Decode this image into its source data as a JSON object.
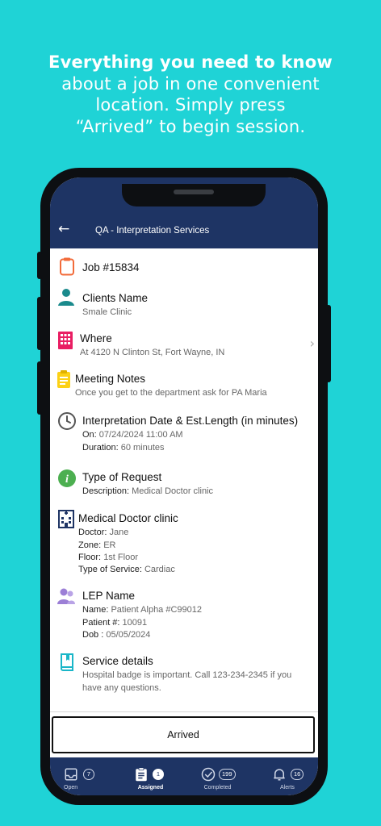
{
  "headline": {
    "bold": "Everything you need to know",
    "line2": "about a job in one convenient",
    "line3": "location. Simply press",
    "line4": "“Arrived” to begin session."
  },
  "appbar": {
    "back": "←",
    "title": "QA - Interpretation Services"
  },
  "job": {
    "title": "Job #15834"
  },
  "client": {
    "title": "Clients Name",
    "value": "Smale Clinic"
  },
  "where": {
    "title": "Where",
    "value": "At 4120 N Clinton St, Fort Wayne, IN"
  },
  "notes": {
    "title": "Meeting Notes",
    "value": "Once you get to the department ask for PA Maria"
  },
  "date": {
    "title": "Interpretation Date & Est.Length (in minutes)",
    "on_label": "On:",
    "on_value": "07/24/2024 11:00 AM",
    "duration_label": "Duration:",
    "duration_value": "60 minutes"
  },
  "request": {
    "title": "Type of Request",
    "desc_label": "Description:",
    "desc_value": "Medical Doctor clinic"
  },
  "clinic": {
    "title": "Medical Doctor clinic",
    "doctor_label": "Doctor:",
    "doctor_value": "Jane",
    "zone_label": "Zone:",
    "zone_value": "ER",
    "floor_label": "Floor:",
    "floor_value": "1st Floor",
    "service_label": "Type of Service:",
    "service_value": "Cardiac"
  },
  "lep": {
    "title": "LEP Name",
    "name_label": "Name:",
    "name_value": "Patient  Alpha #C99012",
    "patient_label": "Patient #:",
    "patient_value": "10091",
    "dob_label": "Dob :",
    "dob_value": "05/05/2024"
  },
  "service": {
    "title": "Service details",
    "value": "Hospital badge is important. Call 123-234-2345 if you have any questions."
  },
  "arrived_button": "Arrived",
  "tabs": [
    {
      "label": "Open",
      "count": "7",
      "icon": "inbox-icon"
    },
    {
      "label": "Assigned",
      "count": "1",
      "icon": "clipboard-icon"
    },
    {
      "label": "Completed",
      "count": "199",
      "icon": "check-circle-icon"
    },
    {
      "label": "Alerts",
      "count": "16",
      "icon": "bell-icon"
    }
  ],
  "colors": {
    "background": "#1fd3d6",
    "navy": "#1e3464"
  }
}
